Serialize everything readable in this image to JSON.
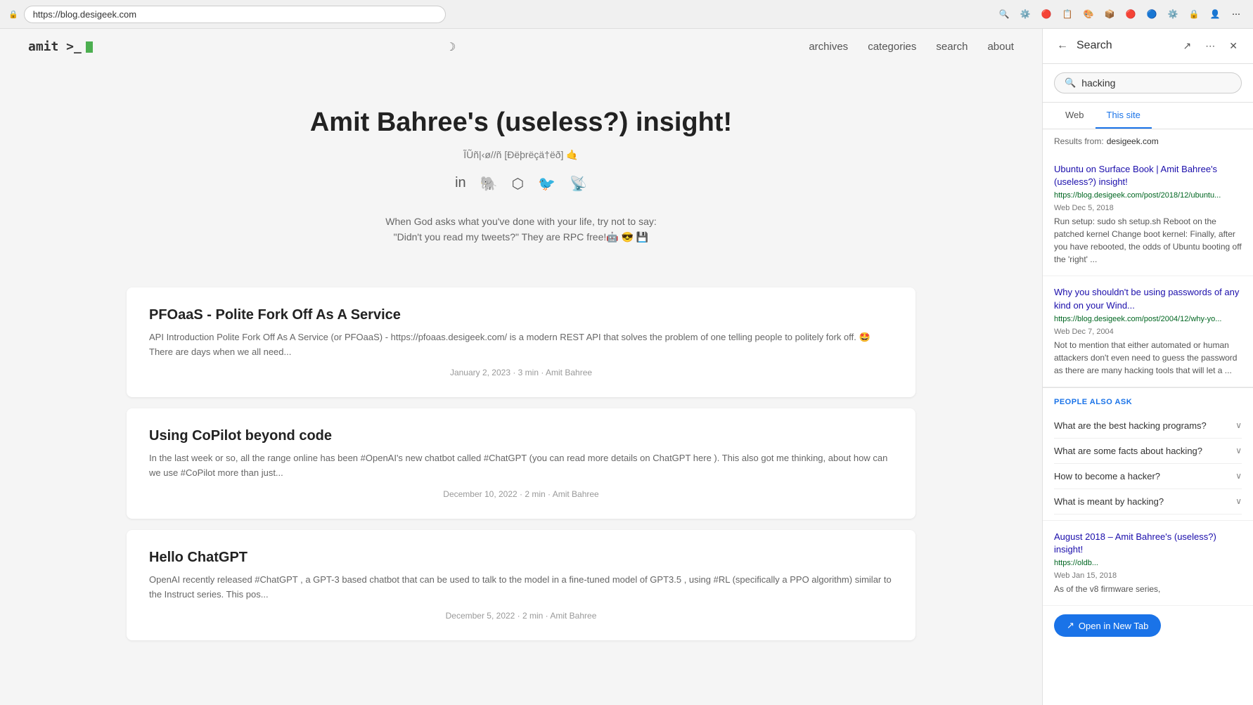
{
  "browser": {
    "url": "https://blog.desigeek.com",
    "search_panel_title": "Search"
  },
  "nav": {
    "logo": "amit >_",
    "links": [
      "archives",
      "categories",
      "search",
      "about"
    ]
  },
  "hero": {
    "title": "Amit Bahree's (useless?) insight!",
    "subtitle": "ĨŨñ|‹ø//ñ [Ðëþrëçä†ëð] 🤙",
    "social_icons": [
      "in",
      "🐘",
      "🐙",
      "🐦",
      "📡"
    ],
    "quote_line1": "When God asks what you've done with your life, try not to say:",
    "quote_line2": "\"Didn't you read my tweets?\" They are RPC free!🤖 😎 💾"
  },
  "posts": [
    {
      "title": "PFOaaS - Polite Fork Off As A Service",
      "excerpt": "API Introduction Polite Fork Off As A Service (or PFOaaS) - https://pfoaas.desigeek.com/ is a modern REST API that solves the problem of one telling people to politely fork off. 🤩 There are days when we all need...",
      "meta": "January 2, 2023 · 3 min · Amit Bahree"
    },
    {
      "title": "Using CoPilot beyond code",
      "excerpt": "In the last week or so, all the range online has been #OpenAI's new chatbot called #ChatGPT (you can read more details on ChatGPT here ). This also got me thinking, about how can we use #CoPilot more than just...",
      "meta": "December 10, 2022 · 2 min · Amit Bahree"
    },
    {
      "title": "Hello ChatGPT",
      "excerpt": "OpenAI recently released #ChatGPT , a GPT-3 based chatbot that can be used to talk to the model in a fine-tuned model of GPT3.5 , using #RL (specifically a PPO algorithm) similar to the Instruct series. This pos...",
      "meta": "December 5, 2022 · 2 min · Amit Bahree"
    }
  ],
  "search_panel": {
    "title": "Search",
    "query": "hacking",
    "tabs": [
      "Web",
      "This site"
    ],
    "active_tab": "This site",
    "results_from_label": "Results from:",
    "results_domain": "desigeek.com",
    "results": [
      {
        "title": "Ubuntu on Surface Book | Amit Bahree's (useless?) insight!",
        "url": "https://blog.desigeek.com/post/2018/12/ubuntu...",
        "meta": "Web Dec 5, 2018",
        "snippet": "Run setup: sudo sh setup.sh Reboot on the patched kernel Change boot kernel: Finally, after you have rebooted, the odds of Ubuntu booting off the 'right' ..."
      },
      {
        "title": "Why you shouldn't be using passwords of any kind on your Wind...",
        "url": "https://blog.desigeek.com/post/2004/12/why-yo...",
        "meta": "Web Dec 7, 2004",
        "snippet": "Not to mention that either automated or human attackers don't even need to guess the password as there are many hacking tools that will let a ..."
      }
    ],
    "people_also_ask": {
      "title": "PEOPLE ALSO ASK",
      "questions": [
        "What are the best hacking programs?",
        "What are some facts about hacking?",
        "How to become a hacker?",
        "What is meant by hacking?"
      ]
    },
    "third_result": {
      "title": "August 2018 – Amit Bahree's (useless?) insight!",
      "url": "https://oldb...",
      "meta": "Web Jan 15, 2018",
      "snippet": "As of the v8 firmware series,"
    },
    "open_new_tab_label": "Open in New Tab"
  }
}
